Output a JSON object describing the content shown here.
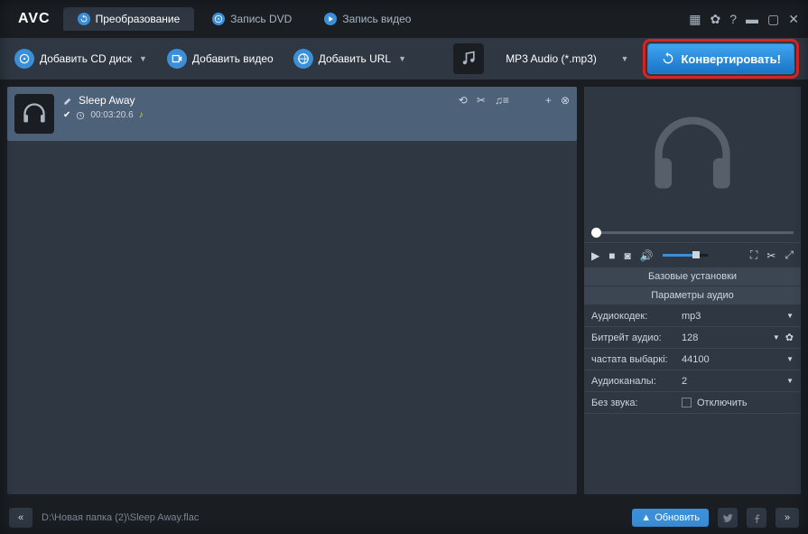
{
  "logo": "AVC",
  "tabs": [
    {
      "label": "Преобразование"
    },
    {
      "label": "Запись DVD"
    },
    {
      "label": "Запись видео"
    }
  ],
  "toolbar": {
    "add_cd": "Добавить CD диск",
    "add_video": "Добавить видео",
    "add_url": "Добавить URL",
    "format": "MP3 Audio (*.mp3)",
    "convert": "Конвертировать!"
  },
  "file": {
    "name": "Sleep Away",
    "duration": "00:03:20.6"
  },
  "settings": {
    "base_header": "Базовые установки",
    "audio_header": "Параметры аудио",
    "rows": [
      {
        "label": "Аудиокодек:",
        "value": "mp3"
      },
      {
        "label": "Битрейт аудио:",
        "value": "128"
      },
      {
        "label": "частата выбаркі:",
        "value": "44100"
      },
      {
        "label": "Аудиоканалы:",
        "value": "2"
      },
      {
        "label": "Без звука:",
        "value": "Отключить"
      }
    ]
  },
  "statusbar": {
    "path": "D:\\Новая папка (2)\\Sleep Away.flac",
    "update": "Обновить"
  }
}
